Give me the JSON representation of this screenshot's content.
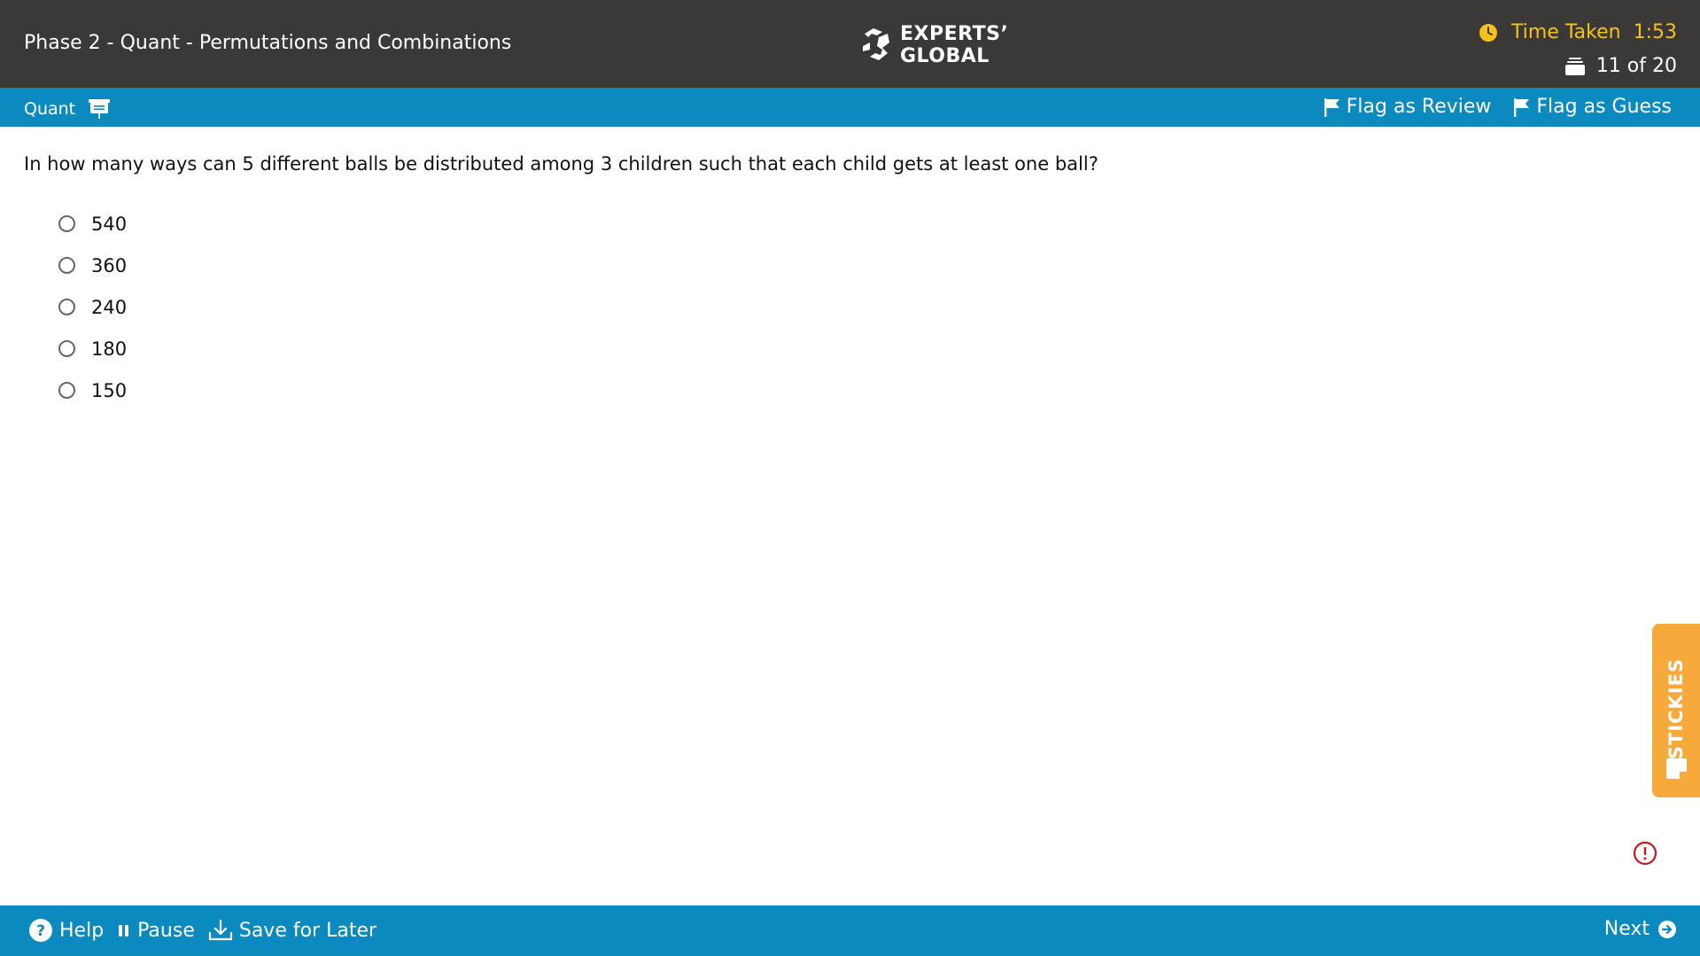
{
  "header": {
    "title": "Phase 2 - Quant - Permutations and Combinations",
    "logo_line1": "EXPERTS’",
    "logo_line2": "GLOBAL",
    "time_label": "Time Taken",
    "time_value": "1:53",
    "progress": "11 of 20"
  },
  "section_bar": {
    "section_label": "Quant",
    "flag_review": "Flag as Review",
    "flag_guess": "Flag as Guess"
  },
  "question": {
    "text": "In how many ways can 5 different balls be distributed among 3 children such that each child gets at least one ball?",
    "options": [
      "540",
      "360",
      "240",
      "180",
      "150"
    ]
  },
  "stickies": {
    "label": "STICKIES"
  },
  "footer": {
    "help": "Help",
    "pause": "Pause",
    "save_for_later": "Save for Later",
    "next": "Next"
  },
  "colors": {
    "header_bg": "#3b3838",
    "bar_blue": "#0b8ac0",
    "timer_yellow": "#f6c21a",
    "stickies_orange": "#f7a93b",
    "alert_red": "#c8161d"
  }
}
